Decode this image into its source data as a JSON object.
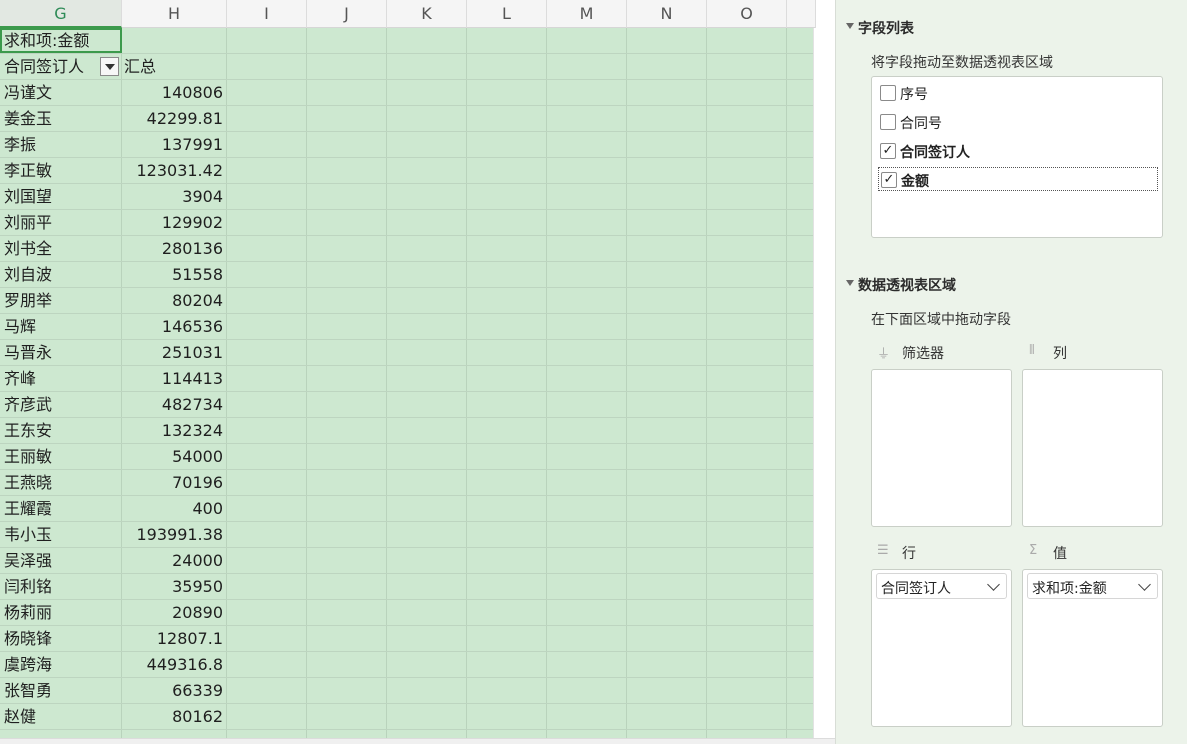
{
  "sheet": {
    "columns": [
      "G",
      "H",
      "I",
      "J",
      "K",
      "L",
      "M",
      "N",
      "O"
    ],
    "header_row": {
      "sum_label": "求和项:金额"
    },
    "label_row": {
      "row_label": "合同签订人",
      "total_label": "汇总"
    },
    "rows": [
      {
        "name": "冯谨文",
        "value": "140806"
      },
      {
        "name": "姜金玉",
        "value": "42299.81"
      },
      {
        "name": "李振",
        "value": "137991"
      },
      {
        "name": "李正敏",
        "value": "123031.42"
      },
      {
        "name": "刘国望",
        "value": "3904"
      },
      {
        "name": "刘丽平",
        "value": "129902"
      },
      {
        "name": "刘书全",
        "value": "280136"
      },
      {
        "name": "刘自波",
        "value": "51558"
      },
      {
        "name": "罗朋举",
        "value": "80204"
      },
      {
        "name": "马辉",
        "value": "146536"
      },
      {
        "name": "马晋永",
        "value": "251031"
      },
      {
        "name": "齐峰",
        "value": "114413"
      },
      {
        "name": "齐彦武",
        "value": "482734"
      },
      {
        "name": "王东安",
        "value": "132324"
      },
      {
        "name": "王丽敏",
        "value": "54000"
      },
      {
        "name": "王燕晓",
        "value": "70196"
      },
      {
        "name": "王耀霞",
        "value": "400"
      },
      {
        "name": "韦小玉",
        "value": "193991.38"
      },
      {
        "name": "吴泽强",
        "value": "24000"
      },
      {
        "name": "闫利铭",
        "value": "35950"
      },
      {
        "name": "杨莉丽",
        "value": "20890"
      },
      {
        "name": "杨晓锋",
        "value": "12807.1"
      },
      {
        "name": "虞跨海",
        "value": "449316.8"
      },
      {
        "name": "张智勇",
        "value": "66339"
      },
      {
        "name": "赵健",
        "value": "80162"
      }
    ],
    "scrollbar": {
      "up": "▲",
      "down": "▼"
    }
  },
  "panel": {
    "field_list_title": "字段列表",
    "field_list_hint": "将字段拖动至数据透视表区域",
    "fields": [
      {
        "label": "序号",
        "checked": false
      },
      {
        "label": "合同号",
        "checked": false
      },
      {
        "label": "合同签订人",
        "checked": true
      },
      {
        "label": "金额",
        "checked": true
      }
    ],
    "areas_title": "数据透视表区域",
    "areas_hint": "在下面区域中拖动字段",
    "filter_label": "筛选器",
    "column_label": "列",
    "row_label": "行",
    "value_label": "值",
    "row_item": "合同签订人",
    "value_item": "求和项:金额",
    "check_glyph": "✓"
  }
}
